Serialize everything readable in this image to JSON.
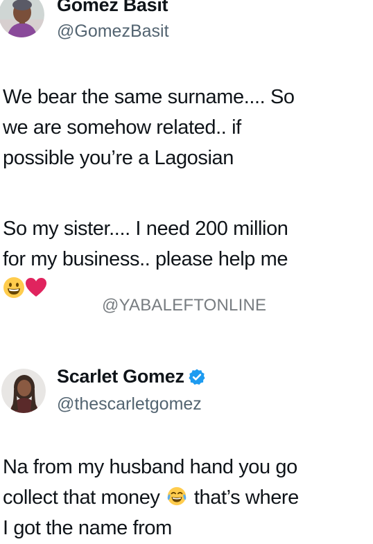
{
  "tweets": [
    {
      "display_name": "Gomez Basit",
      "handle": "@GomezBasit",
      "verified": false,
      "paragraphs": [
        [
          "We bear the same surname.... So",
          "we are somehow related.. if",
          "possible you’re a Lagosian"
        ],
        [
          "So my sister.... I need 200 million",
          "for my business.. please help me"
        ]
      ],
      "trailing_emojis": [
        "grinning-face-emoji",
        "red-heart-emoji"
      ]
    },
    {
      "display_name": "Scarlet Gomez",
      "handle": "@thescarletgomez",
      "verified": true,
      "body_lines": {
        "line1": "Na from my husband hand you go",
        "line2_before_emoji": "collect that money",
        "line2_after_emoji": "that’s where",
        "line3": "I got the name from"
      },
      "inline_emoji": "tears-of-joy-emoji"
    }
  ],
  "watermark": "@YABALEFTONLINE",
  "colors": {
    "text": "#0f1419",
    "handle": "#536471",
    "verified_badge": "#1d9bf0",
    "watermark": "#777c80",
    "heart": "#e0245e",
    "emoji_face": "#ffcc4d"
  }
}
